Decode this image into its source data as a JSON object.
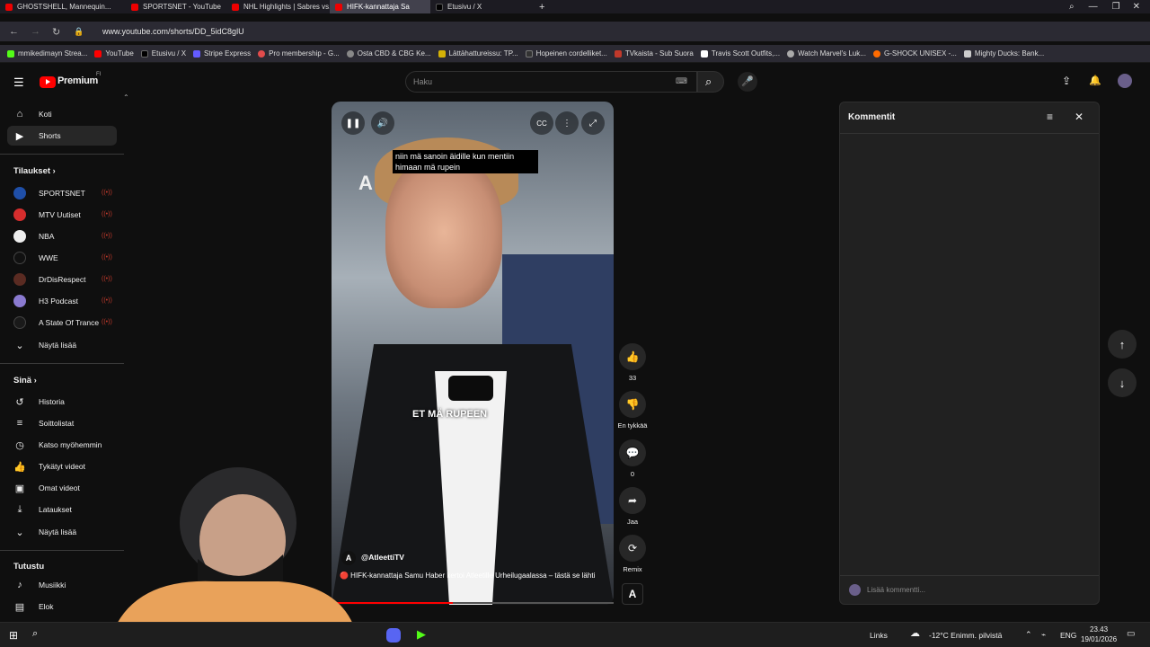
{
  "browser": {
    "tabs": [
      {
        "title": "GHOSTSHELL, Mannequin...",
        "active": false
      },
      {
        "title": "SPORTSNET - YouTube",
        "active": false
      },
      {
        "title": "NHL Highlights | Sabres vs...",
        "active": false
      },
      {
        "title": "HIFK-kannattaja Sa",
        "active": true
      },
      {
        "title": "Etusivu / X",
        "active": false
      }
    ],
    "url": "www.youtube.com/shorts/DD_5idC8glU",
    "bookmarks": [
      {
        "label": "mmikedimayn Strea...",
        "color": "#53fc18"
      },
      {
        "label": "YouTube",
        "color": "#ff0000"
      },
      {
        "label": "Etusivu / X",
        "color": "#000000"
      },
      {
        "label": "Stripe Express",
        "color": "#635bff"
      },
      {
        "label": "Pro membership - G...",
        "color": "#e24c4c"
      },
      {
        "label": "Osta CBD & CBG Ke...",
        "color": "#888888"
      },
      {
        "label": "Lättähattureissu: TP...",
        "color": "#d4b106"
      },
      {
        "label": "Hopeinen cordelliket...",
        "color": "#333333"
      },
      {
        "label": "TVkaista - Sub Suora",
        "color": "#c0392b"
      },
      {
        "label": "Travis Scott Outfits,...",
        "color": "#ffffff"
      },
      {
        "label": "Watch Marvel's Luk...",
        "color": "#aaaaaa"
      },
      {
        "label": "G-SHOCK UNISEX -...",
        "color": "#ff6b00"
      },
      {
        "label": "Mighty Ducks: Bank...",
        "color": "#cccccc"
      }
    ]
  },
  "header": {
    "logo_text": "Premium",
    "logo_sup": "FI",
    "search_placeholder": "Haku"
  },
  "sidebar": {
    "main": [
      {
        "label": "Koti",
        "icon": "home-icon"
      },
      {
        "label": "Shorts",
        "icon": "shorts-icon",
        "active": true
      }
    ],
    "subs_heading": "Tilaukset",
    "subscriptions": [
      {
        "label": "SPORTSNET",
        "color": "#1f4fa8"
      },
      {
        "label": "MTV Uutiset",
        "color": "#d62d2d"
      },
      {
        "label": "NBA",
        "color": "#eeeeee"
      },
      {
        "label": "WWE",
        "color": "#111111"
      },
      {
        "label": "DrDisRespect",
        "color": "#5a2b22"
      },
      {
        "label": "H3 Podcast",
        "color": "#8a7ad0"
      },
      {
        "label": "A State Of Trance",
        "color": "#1a1a1a"
      }
    ],
    "show_more_1": "Näytä lisää",
    "you_heading": "Sinä",
    "you_items": [
      {
        "label": "Historia",
        "icon": "history-icon"
      },
      {
        "label": "Soittolistat",
        "icon": "playlist-icon"
      },
      {
        "label": "Katso myöhemmin",
        "icon": "watch-later-icon"
      },
      {
        "label": "Tykätyt videot",
        "icon": "like-icon"
      },
      {
        "label": "Omat videot",
        "icon": "my-videos-icon"
      },
      {
        "label": "Lataukset",
        "icon": "download-icon"
      }
    ],
    "show_more_2": "Näytä lisää",
    "explore_heading": "Tutustu",
    "explore_items": [
      {
        "label": "Musiikki",
        "icon": "music-icon"
      },
      {
        "label": "Elok",
        "icon": "film-icon"
      }
    ]
  },
  "video": {
    "caption_top": "niin mä sanoin äidille kun mentiin himaan mä rupein",
    "caption_mid": "ET MÄ RUPEEN",
    "channel": "@AtleettiTV",
    "title": "🔴 HIFK-kannattaja Samu Haber kertoi Atleetille Urheilugaalassa – tästä se lähti",
    "progress": 0.43
  },
  "actions": {
    "likes": "33",
    "dislike_label": "En tykkää",
    "comments_count": "0",
    "share_label": "Jaa",
    "remix_label": "Remix"
  },
  "comments": {
    "title": "Kommentit",
    "add_placeholder": "Lisää kommentti..."
  },
  "taskbar": {
    "links": "Links",
    "weather": "-12°C  Enimm. pilvistä",
    "lang": "ENG",
    "time": "23.43",
    "date": "19/01/2026"
  }
}
